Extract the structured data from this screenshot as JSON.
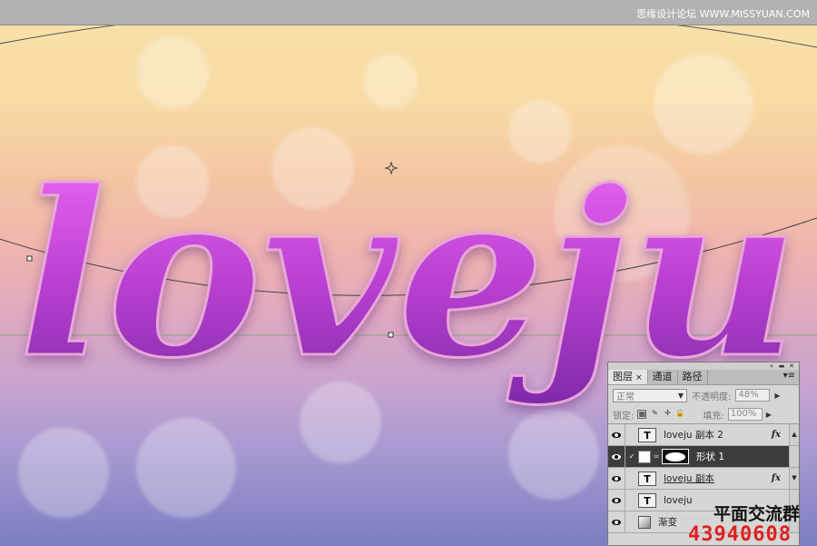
{
  "watermark_top": "思缘设计论坛 WWW.MISSYUAN.COM",
  "canvas_text": "loveju",
  "watermark_bottom": {
    "cn": "平面交流群",
    "num": "43940608"
  },
  "layers_panel": {
    "tabs": [
      {
        "label": "图层",
        "active": true
      },
      {
        "label": "通道",
        "active": false
      },
      {
        "label": "路径",
        "active": false
      }
    ],
    "blend_mode": "正常",
    "opacity_label": "不透明度:",
    "opacity_value": "48%",
    "lock_label": "锁定:",
    "fill_label": "填充:",
    "fill_value": "100%",
    "layers": [
      {
        "name": "loveju 副本 2",
        "type": "text",
        "fx": "fx",
        "selected": false
      },
      {
        "name": "形状 1",
        "type": "shape",
        "fx": "",
        "selected": true
      },
      {
        "name": "loveju 副本",
        "type": "text",
        "fx": "fx",
        "selected": false
      },
      {
        "name": "loveju",
        "type": "text",
        "fx": "",
        "selected": false
      },
      {
        "name": "渐变",
        "type": "gradient",
        "fx": "",
        "selected": false
      }
    ]
  },
  "colors": {
    "text_fill": "#b33fcc",
    "canvas_top": "#f6e1a8",
    "canvas_bottom": "#7b7ec2",
    "selected_layer": "#3c3c3c"
  }
}
